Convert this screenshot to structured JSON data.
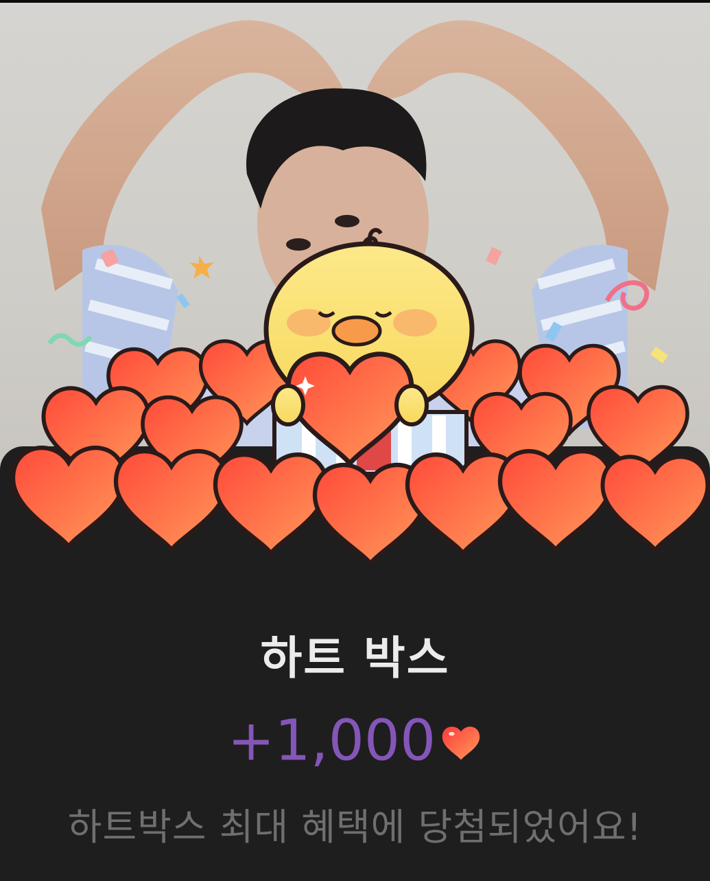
{
  "reward_popup": {
    "title": "하트 박스",
    "amount": "+1,000",
    "message": "하트박스 최대 혜택에 당첨되었어요!",
    "currency_icon": "heart-icon"
  },
  "colors": {
    "background": "#1e1e1e",
    "title": "#ececec",
    "amount": "#8456b8",
    "message": "#6f6f6f",
    "heart": "#f25a3a"
  }
}
